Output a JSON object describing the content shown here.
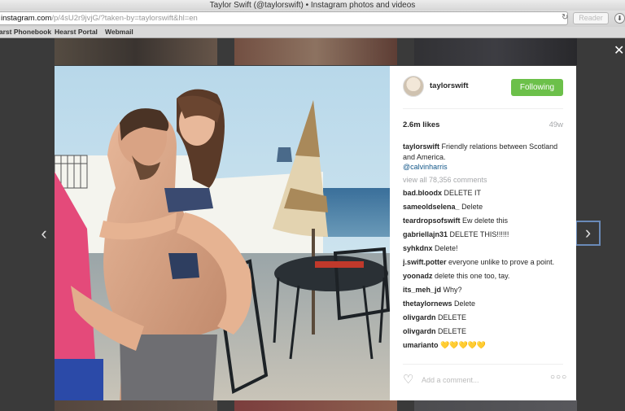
{
  "window": {
    "title": "Taylor Swift (@taylorswift) • Instagram photos and videos"
  },
  "address_bar": {
    "host": "instagram.com",
    "path": "/p/4sU2r9jvjG/?taken-by=taylorswift&hl=en",
    "reader_label": "Reader"
  },
  "bookmarks": [
    "Hearst Phonebook",
    "Hearst Portal",
    "Webmail"
  ],
  "post": {
    "username": "taylorswift",
    "follow_label": "Following",
    "likes": "2.6m likes",
    "time_ago": "49w",
    "caption_user": "taylorswift",
    "caption_text": "Friendly relations between Scotland and America.",
    "caption_mention": "@calvinharris",
    "view_all": "view all 78,356 comments",
    "comments": [
      {
        "user": "bad.bloodx",
        "text": "DELETE IT"
      },
      {
        "user": "sameoldselena_",
        "text": "Delete"
      },
      {
        "user": "teardropsofswift",
        "text": "Ew delete this"
      },
      {
        "user": "gabriellajn31",
        "text": "DELETE THIS!!!!!!"
      },
      {
        "user": "syhkdnx",
        "text": "Delete!"
      },
      {
        "user": "j.swift.potter",
        "text": "everyone unlike to prove a point."
      },
      {
        "user": "yoonadz",
        "text": "delete this one too, tay."
      },
      {
        "user": "its_meh_jd",
        "text": "Why?"
      },
      {
        "user": "thetaylornews",
        "text": "Delete"
      },
      {
        "user": "olivgardn",
        "text": "DELETE"
      },
      {
        "user": "olivgardn",
        "text": "DELETE"
      },
      {
        "user": "umarianto",
        "text": "💛💛💛💛💛"
      }
    ],
    "comment_placeholder": "Add a comment..."
  },
  "icons": {
    "close": "close-icon",
    "prev": "chevron-left-icon",
    "next": "chevron-right-icon",
    "like": "heart-icon",
    "more": "more-options-icon",
    "reload": "reload-icon"
  },
  "colors": {
    "follow_green": "#6cc04a",
    "mention_blue": "#125688",
    "muted_gray": "#a5a7aa"
  }
}
